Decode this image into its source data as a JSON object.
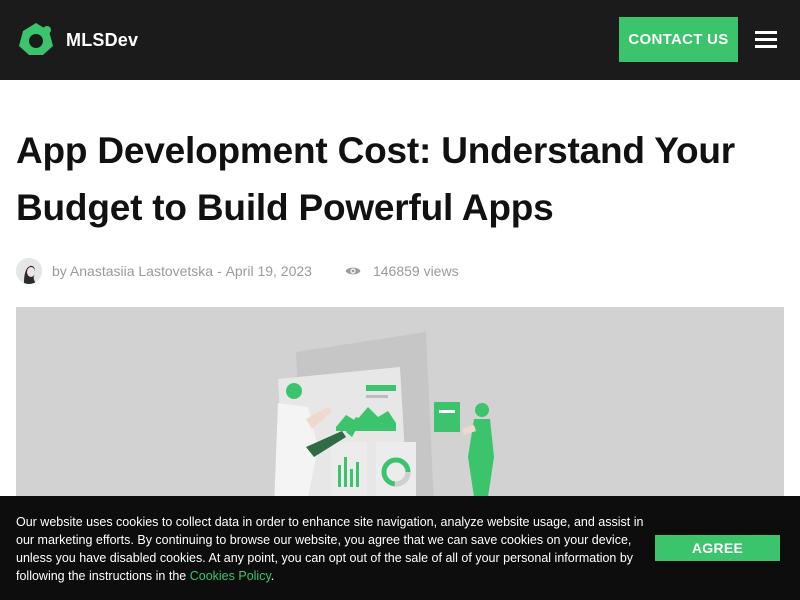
{
  "header": {
    "logo_text": "MLSDev",
    "contact_label": "CONTACT US"
  },
  "article": {
    "title_line1": "App Development Cost: Understand Your",
    "title_line2": "Budget to Build Powerful Apps",
    "byline": "by Anastasiia Lastovetska",
    "separator": " - ",
    "date": "April 19, 2023",
    "views": "146859 views"
  },
  "cookie_banner": {
    "text": "Our website uses cookies to collect data in order to enhance site navigation, analyze website usage, and assist in our marketing efforts. By continuing to browse our website, you agree that we can save cookies on your device, unless you have disabled cookies. At any point, you can opt out of the sale of all of your personal information by following the instructions in the ",
    "link_text": "Cookies Policy",
    "end": ".",
    "agree_label": "AGREE"
  },
  "colors": {
    "accent": "#3cc46c",
    "header_bg": "#1b1b1b",
    "hero_bg": "#d2d2d2",
    "banner_bg": "#0d0d0d"
  },
  "icons": [
    "mlsdev-logo-icon",
    "hamburger-menu-icon",
    "eye-icon",
    "author-avatar"
  ]
}
